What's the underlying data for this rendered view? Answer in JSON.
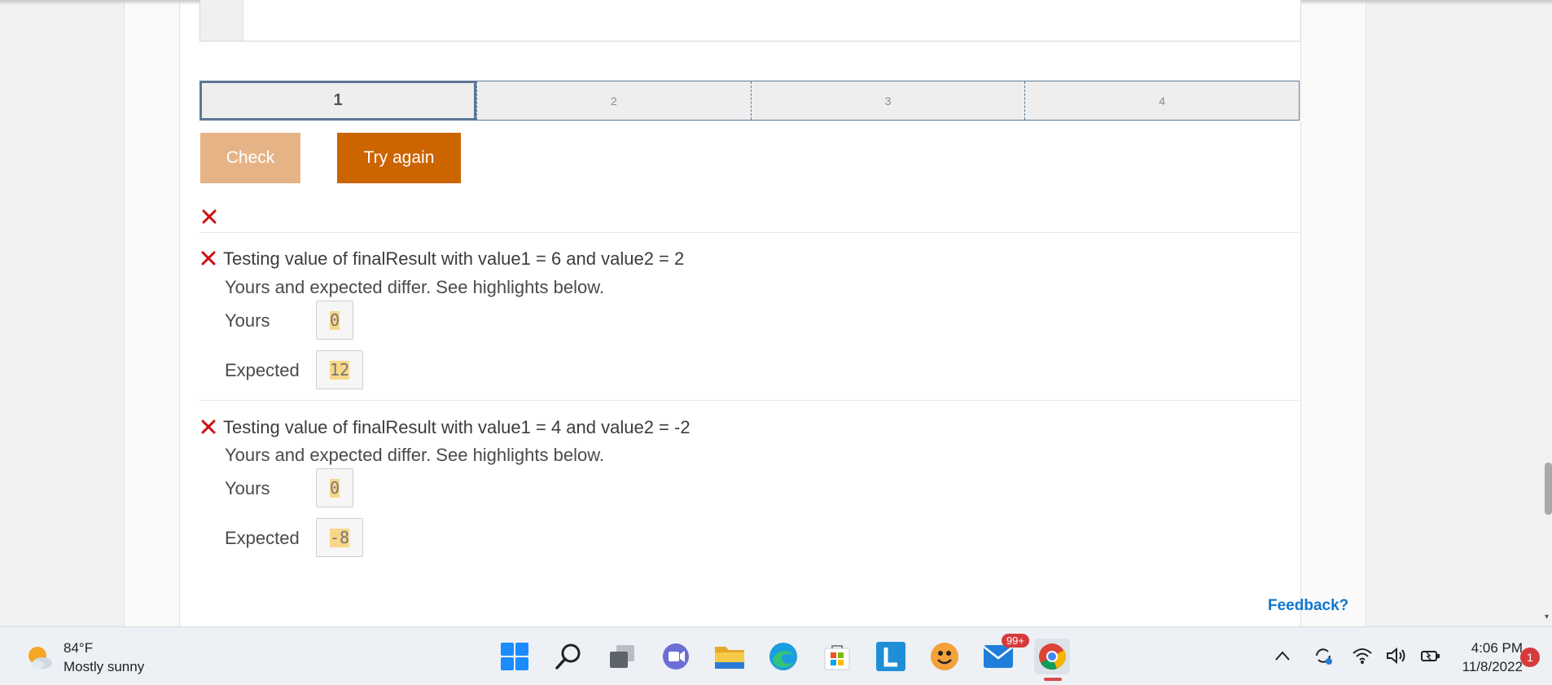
{
  "steps": [
    "1",
    "2",
    "3",
    "4"
  ],
  "buttons": {
    "check": "Check",
    "try_again": "Try again"
  },
  "tests": [
    {
      "title": "Testing value of finalResult with value1 = 6 and value2 = 2",
      "message": "Yours and expected differ. See highlights below.",
      "yours_label": "Yours",
      "yours_value": "0",
      "expected_label": "Expected",
      "expected_value": "12"
    },
    {
      "title": "Testing value of finalResult with value1 = 4 and value2 = -2",
      "message": "Yours and expected differ. See highlights below.",
      "yours_label": "Yours",
      "yours_value": "0",
      "expected_label": "Expected",
      "expected_value": "-8"
    }
  ],
  "feedback_link": "Feedback?",
  "taskbar": {
    "weather_temp": "84°F",
    "weather_desc": "Mostly sunny",
    "mail_badge": "99+",
    "time": "4:06 PM",
    "date": "11/8/2022",
    "notification_count": "1"
  },
  "colors": {
    "check_button": "#e6b387",
    "try_button": "#cc6400",
    "error_x": "#cc1111",
    "highlight": "#f7d88a",
    "link": "#1177cc"
  }
}
